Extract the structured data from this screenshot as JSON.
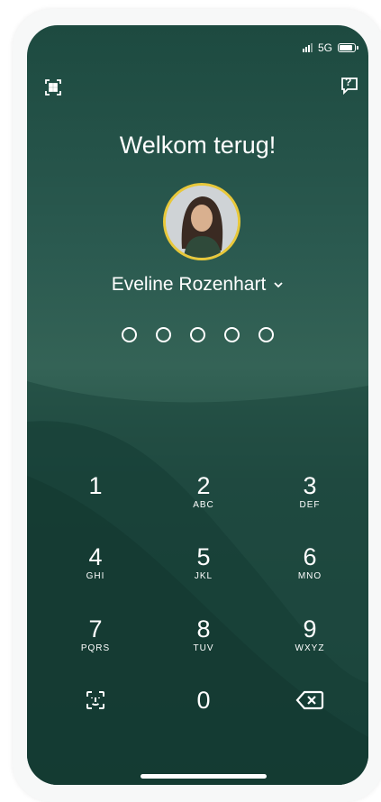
{
  "status": {
    "network": "5G"
  },
  "header": {
    "scan_icon": "qr-scan-icon",
    "help_icon": "help-chat-icon",
    "help_mark": "?"
  },
  "login": {
    "title": "Welkom terug!",
    "user_name": "Eveline Rozenhart",
    "pin_length": 5,
    "pin_entered": 0
  },
  "keypad": {
    "keys": [
      {
        "digit": "1",
        "letters": ""
      },
      {
        "digit": "2",
        "letters": "ABC"
      },
      {
        "digit": "3",
        "letters": "DEF"
      },
      {
        "digit": "4",
        "letters": "GHI"
      },
      {
        "digit": "5",
        "letters": "JKL"
      },
      {
        "digit": "6",
        "letters": "MNO"
      },
      {
        "digit": "7",
        "letters": "PQRS"
      },
      {
        "digit": "8",
        "letters": "TUV"
      },
      {
        "digit": "9",
        "letters": "WXYZ"
      },
      {
        "digit": "0",
        "letters": ""
      }
    ],
    "face_id_icon": "face-id-icon",
    "backspace_icon": "backspace-icon"
  },
  "colors": {
    "accent_ring": "#e8c83a",
    "background": "#1f4a41"
  }
}
